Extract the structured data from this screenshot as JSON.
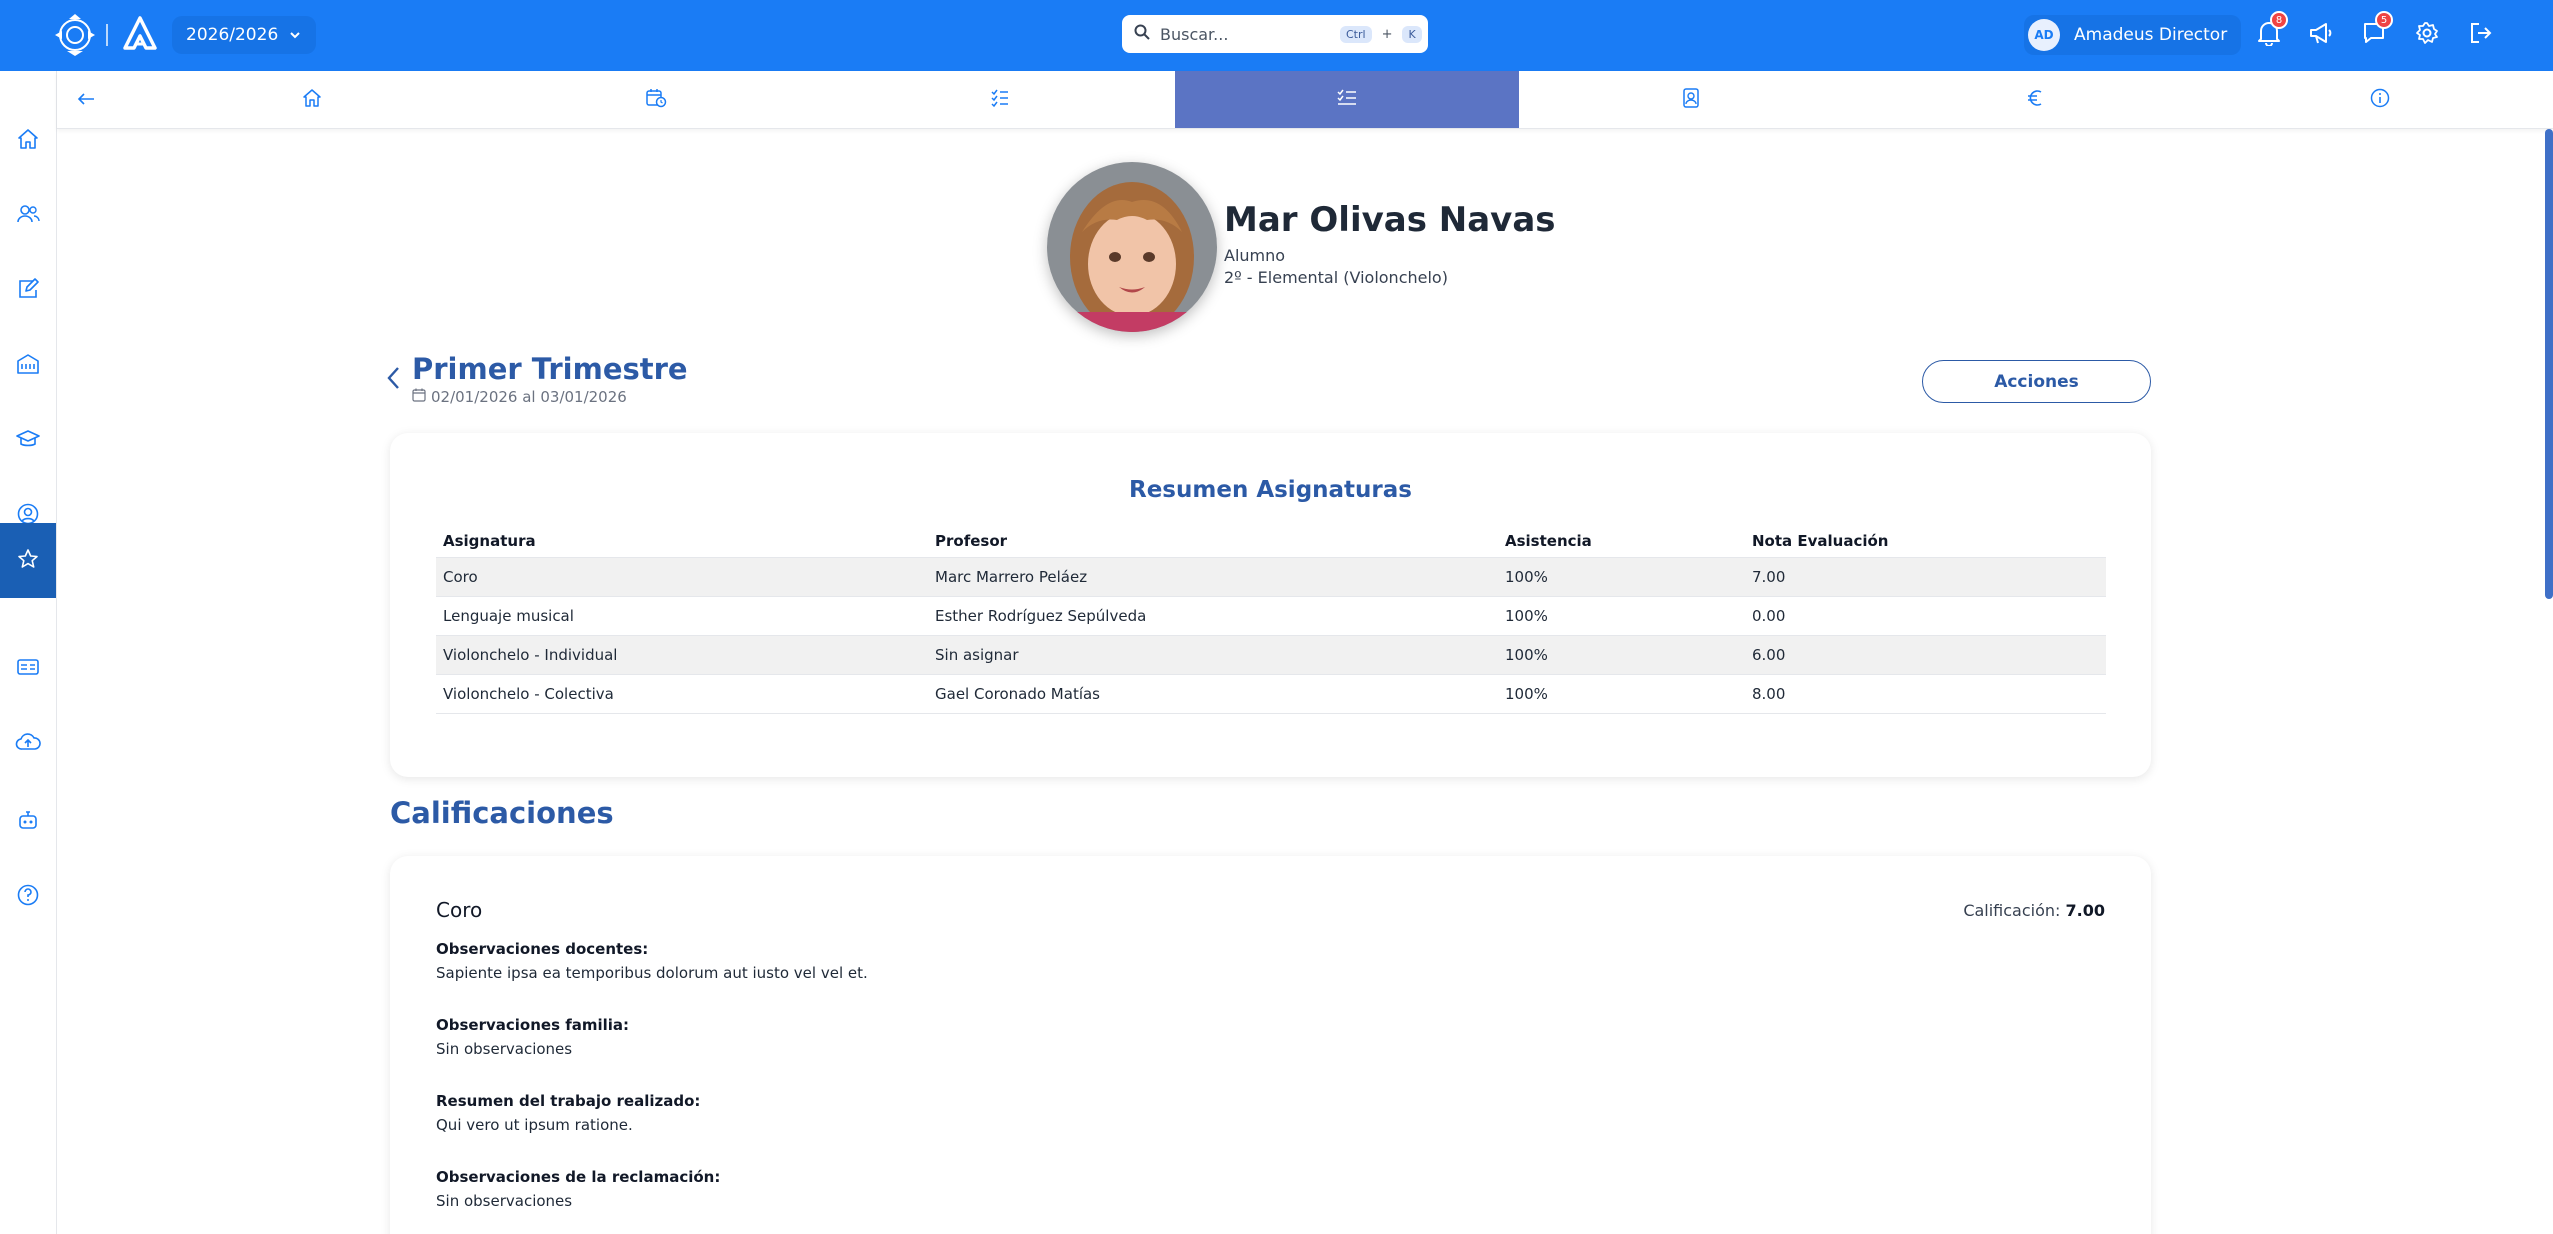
{
  "header": {
    "year": "2026/2026",
    "search_placeholder": "Buscar...",
    "shortcut_ctrl": "Ctrl",
    "shortcut_plus": "+",
    "shortcut_key": "K",
    "user_initials": "AD",
    "user_name": "Amadeus Director",
    "notifications_count": "8",
    "messages_count": "5"
  },
  "sidebar": {
    "items": [
      "home-icon",
      "users-icon",
      "edit-icon",
      "building-icon",
      "graduation-cap-icon",
      "user-circle-icon",
      "star-icon",
      "id-card-icon",
      "cloud-upload-icon",
      "robot-icon",
      "help-circle-icon"
    ],
    "active_index": 6
  },
  "subnav": {
    "tabs": [
      "home-icon",
      "calendar-clock-icon",
      "checklist-icon",
      "list-check-icon",
      "contact-card-icon",
      "euro-icon",
      "info-icon"
    ],
    "active_index": 3
  },
  "student": {
    "name": "Mar Olivas Navas",
    "role": "Alumno",
    "course": "2º - Elemental (Violonchelo)"
  },
  "period": {
    "title": "Primer Trimestre",
    "dates": "02/01/2026 al 03/01/2026",
    "actions_label": "Acciones"
  },
  "summary": {
    "title": "Resumen Asignaturas",
    "headers": [
      "Asignatura",
      "Profesor",
      "Asistencia",
      "Nota Evaluación"
    ],
    "rows": [
      [
        "Coro",
        "Marc Marrero Peláez",
        "100%",
        "7.00"
      ],
      [
        "Lenguaje musical",
        "Esther Rodríguez Sepúlveda",
        "100%",
        "0.00"
      ],
      [
        "Violonchelo - Individual",
        "Sin asignar",
        "100%",
        "6.00"
      ],
      [
        "Violonchelo - Colectiva",
        "Gael Coronado Matías",
        "100%",
        "8.00"
      ]
    ]
  },
  "grades": {
    "title": "Calificaciones",
    "subject": "Coro",
    "grade_label": "Calificación:",
    "grade_value": "7.00",
    "observations": [
      {
        "label": "Observaciones docentes:",
        "text": "Sapiente ipsa ea temporibus dolorum aut iusto vel vel et."
      },
      {
        "label": "Observaciones familia:",
        "text": "Sin observaciones"
      },
      {
        "label": "Resumen del trabajo realizado:",
        "text": "Qui vero ut ipsum ratione."
      },
      {
        "label": "Observaciones de la reclamación:",
        "text": "Sin observaciones"
      }
    ]
  },
  "colors": {
    "topbar": "#1a7cf5",
    "accent": "#2c5aa6",
    "active_tab": "#5b74c4",
    "sidebar_active": "#1a5fb4"
  }
}
